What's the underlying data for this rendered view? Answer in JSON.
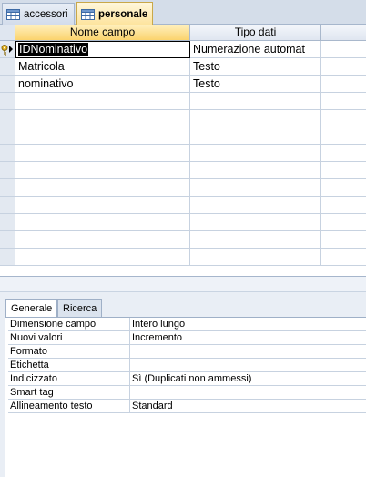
{
  "tabs": [
    {
      "label": "accessori",
      "icon": "table-icon"
    },
    {
      "label": "personale",
      "icon": "table-icon"
    }
  ],
  "grid": {
    "headers": [
      "Nome campo",
      "Tipo dati",
      ""
    ],
    "rows": [
      {
        "name": "IDNominativo",
        "type": "Numerazione automat",
        "desc": "",
        "primary_key": true
      },
      {
        "name": "Matricola",
        "type": "Testo",
        "desc": ""
      },
      {
        "name": "nominativo",
        "type": "Testo",
        "desc": ""
      }
    ]
  },
  "props": {
    "tabs": [
      "Generale",
      "Ricerca"
    ],
    "rows": [
      {
        "label": "Dimensione campo",
        "value": "Intero lungo"
      },
      {
        "label": "Nuovi valori",
        "value": "Incremento"
      },
      {
        "label": "Formato",
        "value": ""
      },
      {
        "label": "Etichetta",
        "value": ""
      },
      {
        "label": "Indicizzato",
        "value": "Sì (Duplicati non ammessi)"
      },
      {
        "label": "Smart tag",
        "value": ""
      },
      {
        "label": "Allineamento testo",
        "value": "Standard"
      }
    ]
  },
  "colors": {
    "active_tab": "#fde39b",
    "header_selected": "#fbd36d",
    "grid_line": "#c7d2e0",
    "chrome": "#d4dde9"
  }
}
